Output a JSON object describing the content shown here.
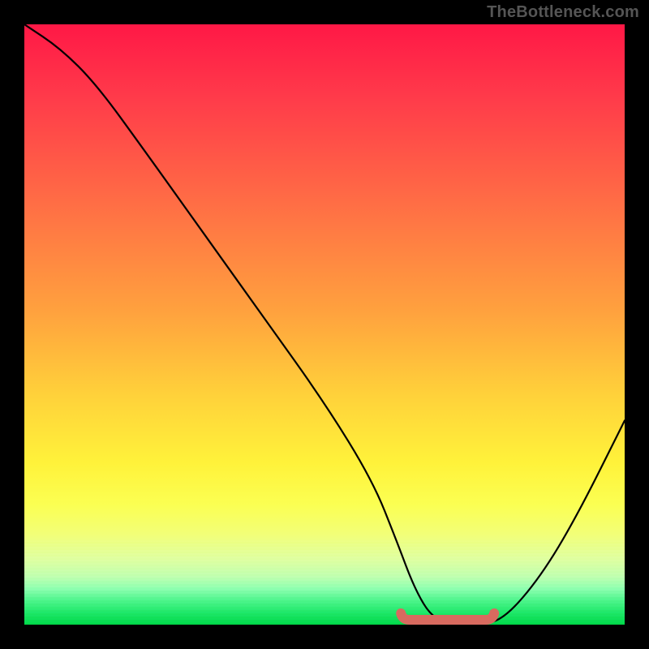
{
  "watermark": "TheBottleneck.com",
  "chart_data": {
    "type": "line",
    "title": "",
    "xlabel": "",
    "ylabel": "",
    "xlim": [
      0,
      100
    ],
    "ylim": [
      0,
      100
    ],
    "grid": false,
    "legend": false,
    "series": [
      {
        "name": "bottleneck-percentage-curve",
        "x": [
          0,
          6,
          12,
          20,
          30,
          40,
          50,
          58,
          62,
          65,
          68,
          72,
          76,
          80,
          86,
          92,
          100
        ],
        "y": [
          100,
          96,
          90,
          79,
          65,
          51,
          37,
          24,
          14,
          6,
          1,
          0,
          0,
          1,
          8,
          18,
          34
        ]
      }
    ],
    "trough_highlight": {
      "name": "optimal-range",
      "x_start": 63,
      "x_end": 78,
      "y": 0,
      "color": "#d86a5f"
    },
    "gradient_stops": [
      {
        "pos": 0,
        "color": "#ff1846"
      },
      {
        "pos": 30,
        "color": "#ff6e45"
      },
      {
        "pos": 62,
        "color": "#ffd23a"
      },
      {
        "pos": 85,
        "color": "#f2ff78"
      },
      {
        "pos": 100,
        "color": "#00d848"
      }
    ]
  }
}
